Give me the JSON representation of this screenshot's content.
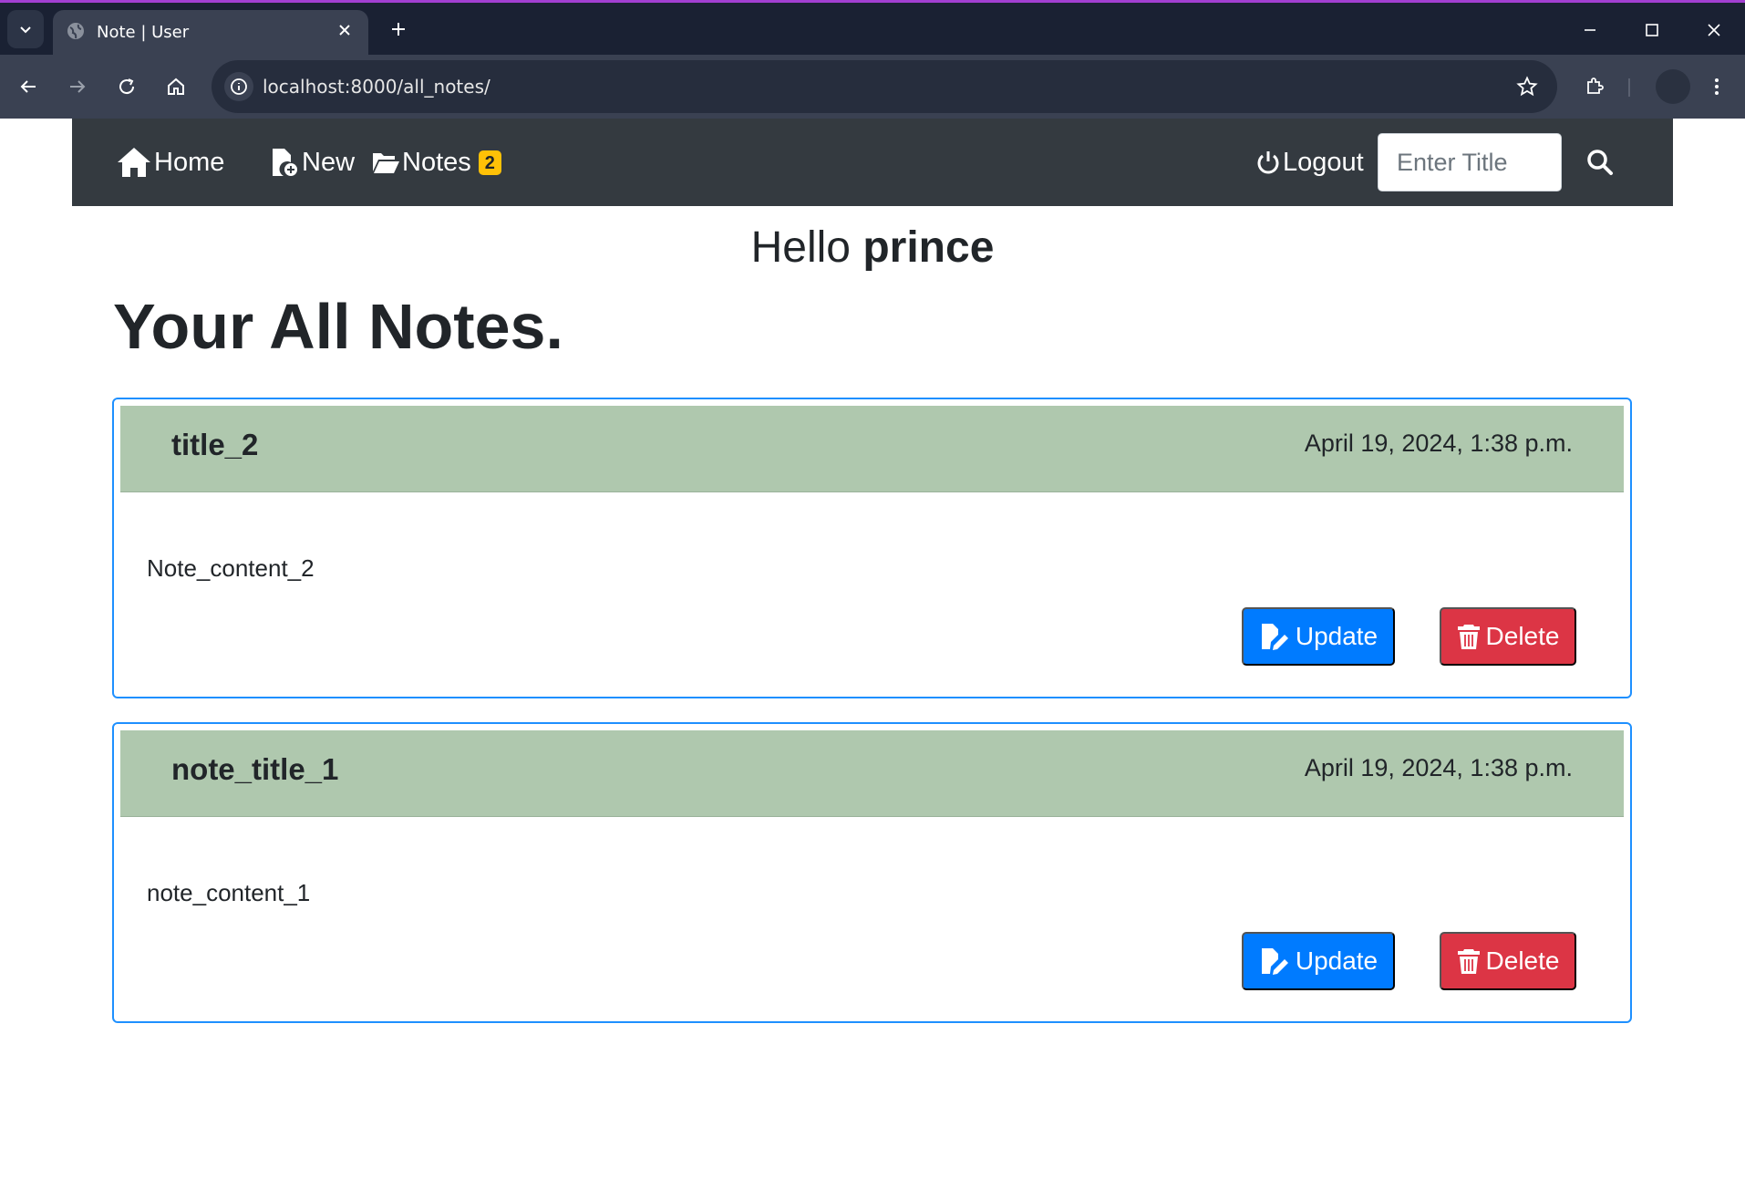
{
  "browser": {
    "tab_title": "Note | User",
    "url": "localhost:8000/all_notes/"
  },
  "navbar": {
    "home_label": "Home",
    "new_label": "New",
    "notes_label": "Notes",
    "notes_count": "2",
    "logout_label": "Logout",
    "search_placeholder": "Enter Title"
  },
  "greeting": {
    "prefix": "Hello",
    "username": "prince"
  },
  "page_title": "Your All Notes.",
  "notes": [
    {
      "title": "title_2",
      "date": "April 19, 2024, 1:38 p.m.",
      "content": "Note_content_2",
      "update_label": "Update",
      "delete_label": "Delete"
    },
    {
      "title": "note_title_1",
      "date": "April 19, 2024, 1:38 p.m.",
      "content": "note_content_1",
      "update_label": "Update",
      "delete_label": "Delete"
    }
  ],
  "colors": {
    "navbar_bg": "#343a40",
    "badge": "#ffc107",
    "card_header": "#afc8ae",
    "card_border": "#1e90ff",
    "update_button": "#007bff",
    "delete_button": "#dc3545"
  }
}
